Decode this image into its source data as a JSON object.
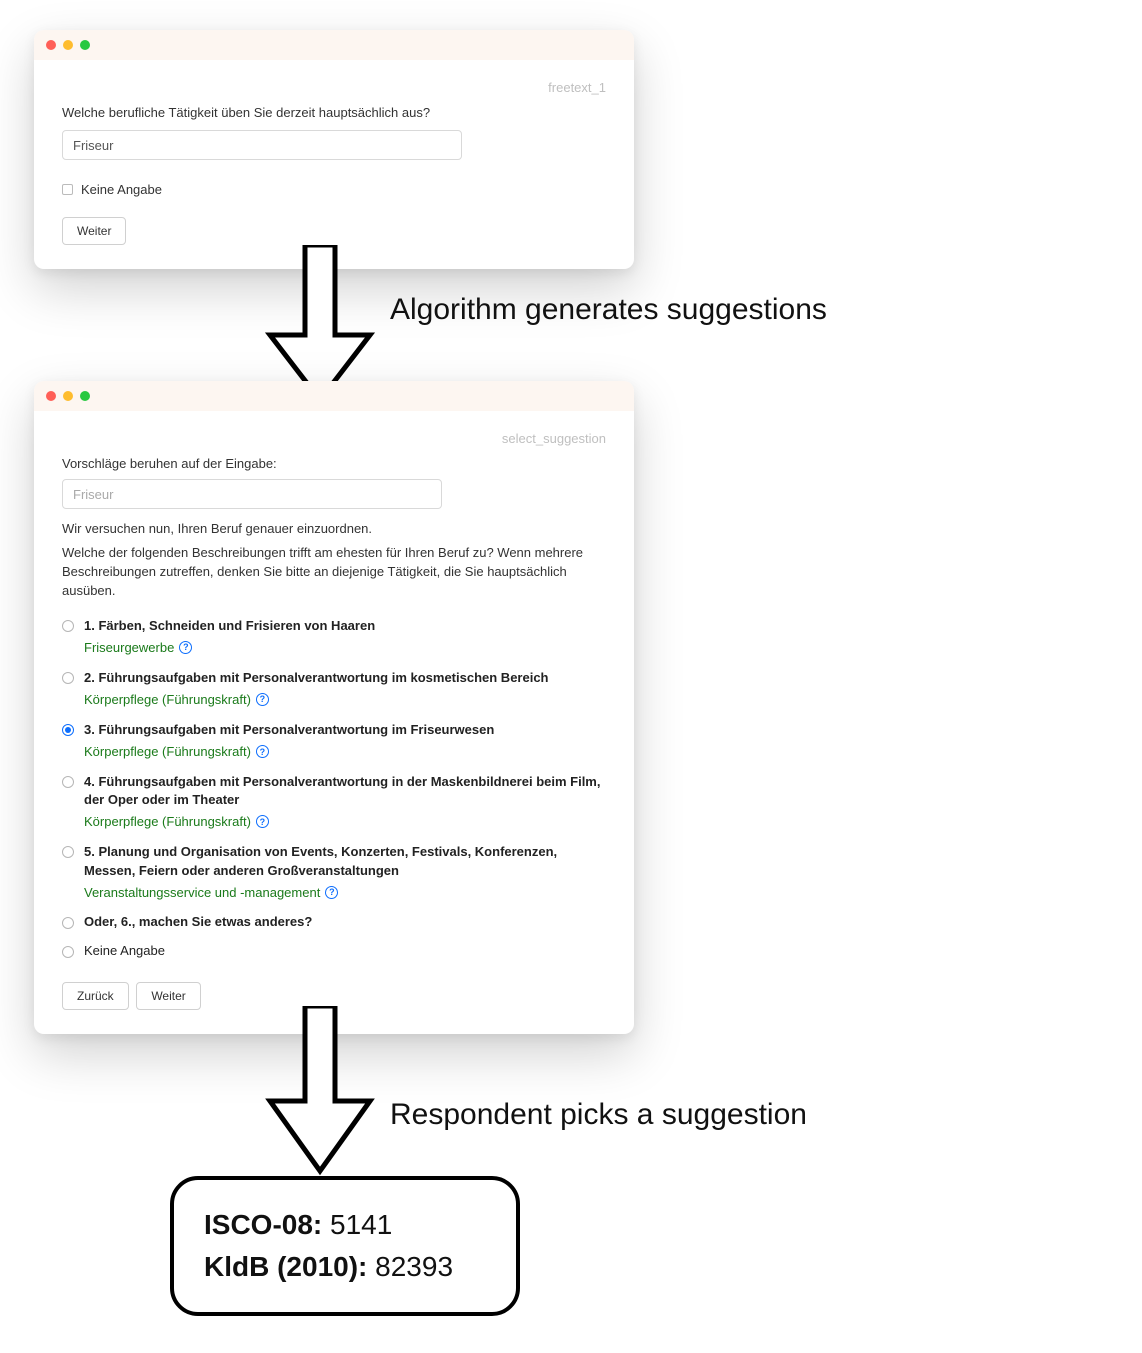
{
  "window1": {
    "screen_id": "freetext_1",
    "question": "Welche berufliche Tätigkeit üben Sie derzeit hauptsächlich aus?",
    "input_value": "Friseur",
    "no_answer": "Keine Angabe",
    "next_btn": "Weiter"
  },
  "arrow1_label": "Algorithm generates suggestions",
  "window2": {
    "screen_id": "select_suggestion",
    "intro1": "Vorschläge beruhen auf der Eingabe:",
    "input_value": "Friseur",
    "intro2": "Wir versuchen nun, Ihren Beruf genauer einzuordnen.",
    "intro3": "Welche der folgenden Beschreibungen trifft am ehesten für Ihren Beruf zu? Wenn mehrere Beschreibungen zutreffen, denken Sie bitte an diejenige Tätigkeit, die Sie hauptsächlich ausüben.",
    "options": [
      {
        "title": "1. Färben, Schneiden und Frisieren von Haaren",
        "sub": "Friseurgewerbe",
        "selected": false
      },
      {
        "title": "2. Führungsaufgaben mit Personalverantwortung im kosmetischen Bereich",
        "sub": "Körperpflege (Führungskraft)",
        "selected": false
      },
      {
        "title": "3. Führungsaufgaben mit Personalverantwortung im Friseurwesen",
        "sub": "Körperpflege (Führungskraft)",
        "selected": true
      },
      {
        "title": "4. Führungsaufgaben mit Personalverantwortung in der Maskenbildnerei beim Film, der Oper oder im Theater",
        "sub": "Körperpflege (Führungskraft)",
        "selected": false
      },
      {
        "title": "5. Planung und Organisation von Events, Konzerten, Festivals, Konferenzen, Messen, Feiern oder anderen Großveranstaltungen",
        "sub": "Veranstaltungsservice und -management",
        "selected": false
      }
    ],
    "other_label": "Oder, 6., machen Sie etwas anderes?",
    "no_answer": "Keine Angabe",
    "back_btn": "Zurück",
    "next_btn": "Weiter"
  },
  "arrow2_label": "Respondent picks a suggestion",
  "result": {
    "isco_key": "ISCO-08:",
    "isco_val": "5141",
    "kldb_key": "KldB (2010):",
    "kldb_val": "82393"
  }
}
